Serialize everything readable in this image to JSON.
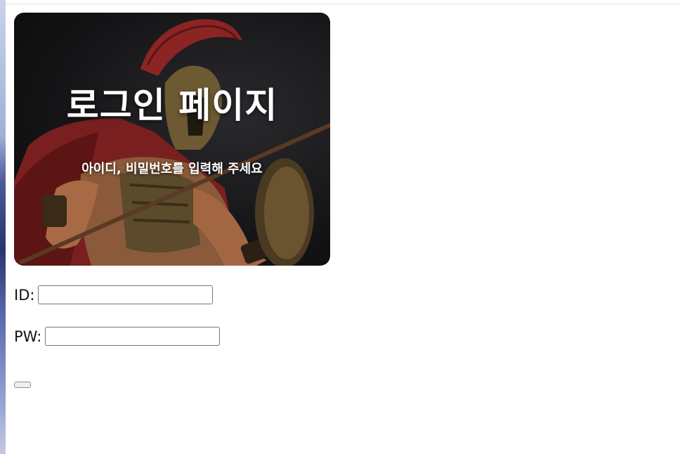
{
  "hero": {
    "title": "로그인 페이지",
    "subtitle": "아이디, 비밀번호를 입력해 주세요"
  },
  "form": {
    "id_label": "ID:",
    "id_value": "",
    "pw_label": "PW:",
    "pw_value": "",
    "submit_label": ""
  }
}
